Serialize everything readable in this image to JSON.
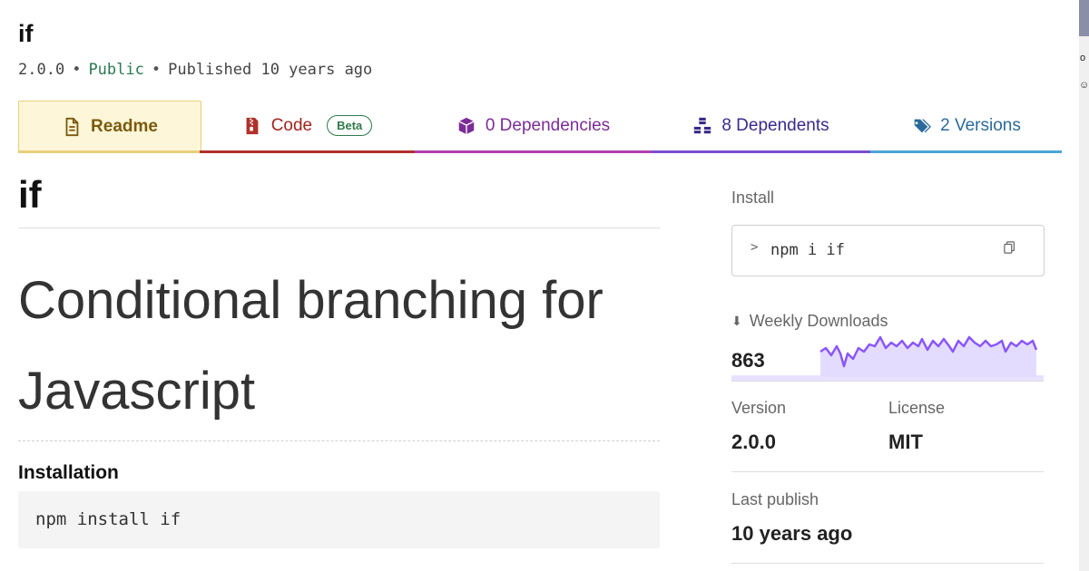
{
  "package": {
    "name": "if",
    "version": "2.0.0",
    "visibility": "Public",
    "published": "Published 10 years ago"
  },
  "tabs": {
    "readme": "Readme",
    "code": "Code",
    "code_badge": "Beta",
    "dependencies": "0 Dependencies",
    "dependents": "8 Dependents",
    "versions": "2 Versions"
  },
  "readme": {
    "title": "if",
    "heading": "Conditional branching for Javascript",
    "install_heading": "Installation",
    "install_code": "npm install if"
  },
  "sidebar": {
    "install_label": "Install",
    "install_command": "npm i if",
    "weekly_downloads_label": "Weekly Downloads",
    "weekly_downloads": "863",
    "version_label": "Version",
    "version": "2.0.0",
    "license_label": "License",
    "license": "MIT",
    "last_publish_label": "Last publish",
    "last_publish": "10 years ago"
  },
  "colors": {
    "readme_tab": "#fef6d8",
    "code_tab": "#a1241d",
    "deps_tab": "#7b2c98",
    "dependents_tab": "#3a2a8a",
    "versions_tab": "#2a6a9a",
    "sparkline": "#8956ff"
  },
  "icons": {
    "readme": "document-icon",
    "code": "zip-file-icon",
    "dependencies": "box-icon",
    "dependents": "boxes-icon",
    "versions": "tags-icon",
    "install": "copy-icon",
    "downloads": "download-icon"
  }
}
